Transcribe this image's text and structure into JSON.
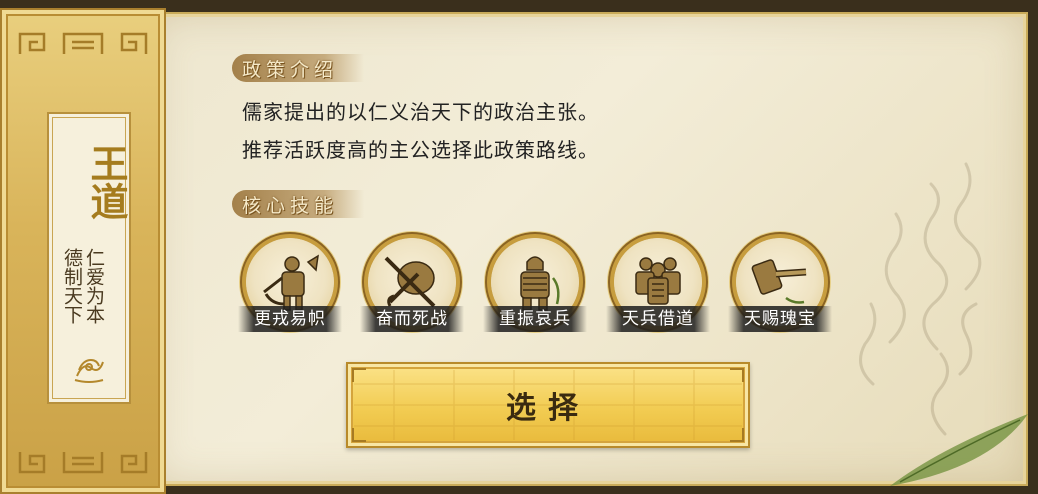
{
  "policy": {
    "name": "王道",
    "motto_lines": [
      "仁爱为本",
      "德制天下"
    ]
  },
  "intro": {
    "header": "政策介绍",
    "lines": [
      "儒家提出的以仁义治天下的政治主张。",
      "推荐活跃度高的主公选择此政策路线。"
    ]
  },
  "skills": {
    "header": "核心技能",
    "items": [
      {
        "name": "更戎易帜",
        "icon": "soldier-flag-icon"
      },
      {
        "name": "奋而死战",
        "icon": "crossed-swords-shield-icon"
      },
      {
        "name": "重振哀兵",
        "icon": "armored-soldier-icon"
      },
      {
        "name": "天兵借道",
        "icon": "soldier-group-icon"
      },
      {
        "name": "天赐瑰宝",
        "icon": "hammer-icon"
      }
    ]
  },
  "actions": {
    "select_label": "选择"
  },
  "colors": {
    "banner_gold": "#d9b45a",
    "parchment": "#f0e8d0",
    "button_gold": "#f2cc52",
    "title_gold": "#a57c1e"
  }
}
